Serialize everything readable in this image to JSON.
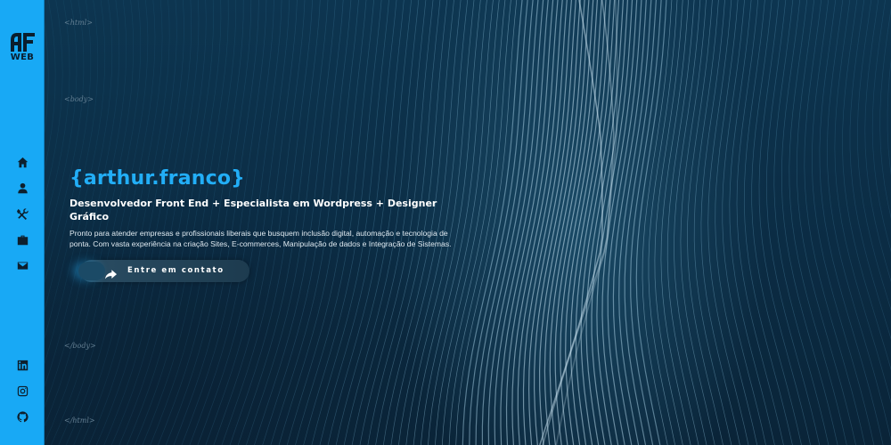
{
  "sidebar": {
    "logo": {
      "mark": "AF",
      "text": "WEB"
    },
    "nav": [
      {
        "name": "home",
        "icon": "home-icon"
      },
      {
        "name": "about",
        "icon": "user-icon"
      },
      {
        "name": "skills",
        "icon": "tools-icon"
      },
      {
        "name": "portfolio",
        "icon": "briefcase-icon"
      },
      {
        "name": "contact",
        "icon": "envelope-icon"
      }
    ],
    "social": [
      {
        "name": "linkedin",
        "icon": "linkedin-icon"
      },
      {
        "name": "instagram",
        "icon": "instagram-icon"
      },
      {
        "name": "github",
        "icon": "github-icon"
      }
    ]
  },
  "tags": {
    "html_open": "<html>",
    "body_open": "<body>",
    "body_close": "</body>",
    "html_close": "</html>"
  },
  "hero": {
    "name": "{arthur.franco}",
    "role": "Desenvolvedor Front End + Especialista em Wordpress + Designer Gráfico",
    "description": "Pronto para atender empresas e profissionais liberais que busquem inclusão digital, automação e tecnologia de ponta. Com vasta experiência na criação Sites, E-commerces, Manipulação de dados e Integração de Sistemas.",
    "cta_label": "Entre em contato",
    "cta_icon": "share-arrow-icon"
  },
  "colors": {
    "sidebar": "#18a9f5",
    "accent": "#22aef7",
    "background": "#0b2a40"
  }
}
